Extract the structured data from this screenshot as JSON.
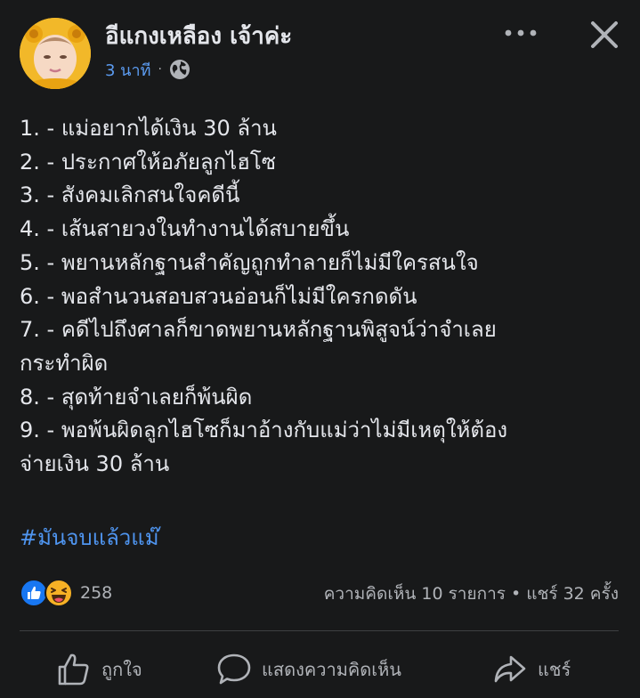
{
  "post": {
    "author": "อีแกงเหลือง เจ้าค่ะ",
    "time": "3 นาที",
    "separator": "·",
    "privacy_icon": "globe-icon",
    "lines": [
      "1. - แม่อยากได้เงิน 30 ล้าน",
      "2. - ประกาศให้อภัยลูกไฮโซ",
      "3. - สังคมเลิกสนใจคดีนี้",
      "4. - เส้นสายวงในทำงานได้สบายขึ้น",
      "5. - พยานหลักฐานสำคัญถูกทำลายก็ไม่มีใครสนใจ",
      "6. - พอสำนวนสอบสวนอ่อนก็ไม่มีใครกดดัน",
      "7. - คดีไปถึงศาลก็ขาดพยานหลักฐานพิสูจน์ว่าจำเลย",
      "กระทำผิด",
      "8. - สุดท้ายจำเลยก็พ้นผิด",
      "9. - พอพ้นผิดลูกไฮโซก็มาอ้างกับแม่ว่าไม่มีเหตุให้ต้อง",
      "จ่ายเงิน 30 ล้าน"
    ],
    "hashtag": "#มันจบแล้วแม๊"
  },
  "reactions": {
    "icons": [
      "like-reaction-icon",
      "haha-reaction-icon"
    ],
    "count": "258"
  },
  "stats": {
    "comments": "ความคิดเห็น 10 รายการ",
    "separator": "•",
    "shares": "แชร์ 32 ครั้ง"
  },
  "actions": {
    "like_label": "ถูกใจ",
    "comment_label": "แสดงความคิดเห็น",
    "share_label": "แชร์"
  },
  "colors": {
    "background": "#18191a",
    "text": "#e4e6eb",
    "secondary_text": "#b0b3b8",
    "link_blue": "#4f95f0",
    "like_blue": "#1877f2",
    "haha_yellow": "#f7b125"
  }
}
